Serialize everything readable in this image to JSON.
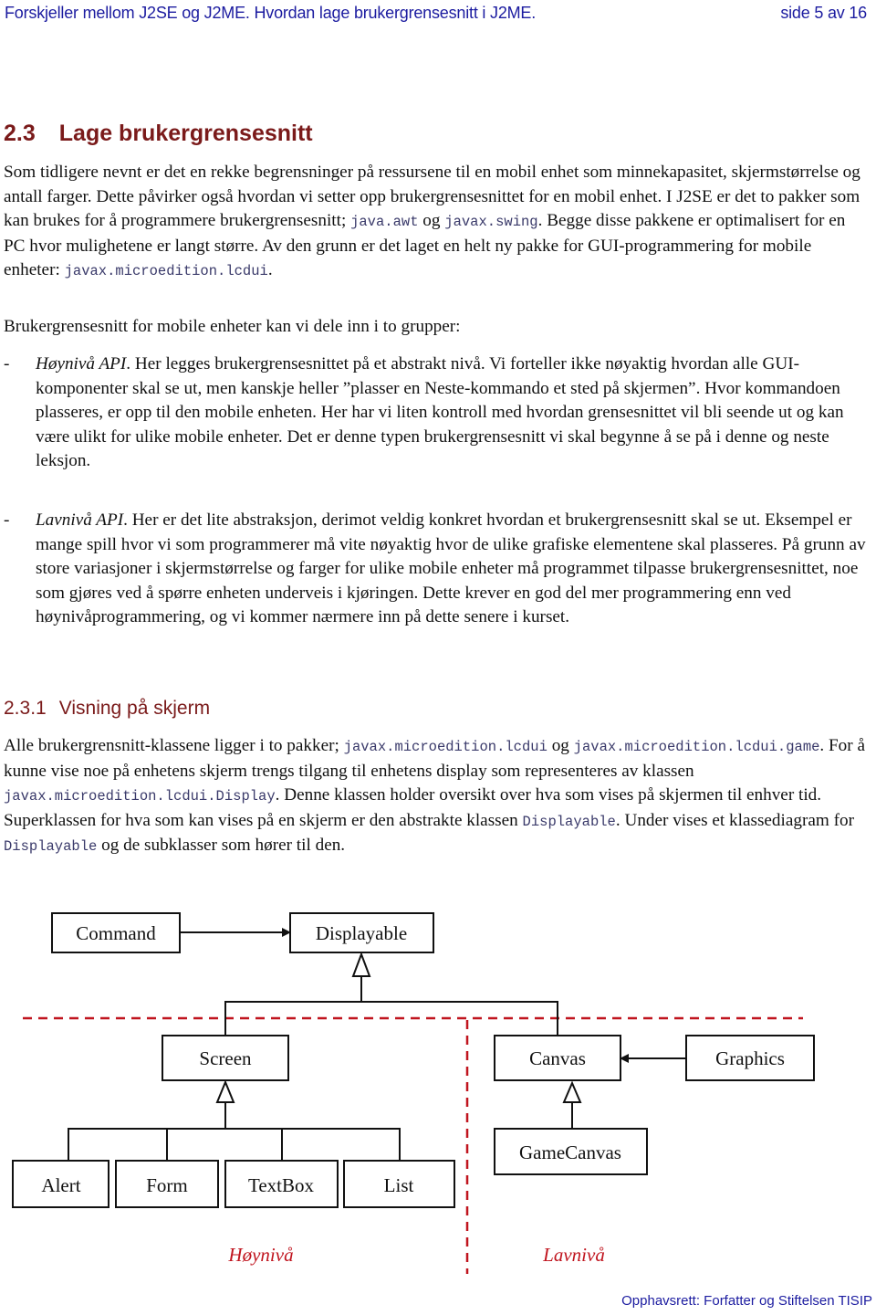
{
  "header": {
    "title": "Forskjeller mellom J2SE og J2ME. Hvordan lage brukergrensesnitt i J2ME.",
    "page": "side 5 av 16"
  },
  "section": {
    "number": "2.3",
    "title": "Lage brukergrensesnitt"
  },
  "intro": {
    "t1": "Som tidligere nevnt er det en rekke begrensninger på ressursene til en mobil enhet som minnekapasitet, skjermstørrelse og antall farger. Dette påvirker også hvordan vi setter opp brukergrensesnittet for en mobil enhet. I J2SE er det to pakker som kan brukes for å programmere brukergrensesnitt; ",
    "code1": "java.awt",
    "t2": " og ",
    "code2": "javax.swing",
    "t3": ". Begge disse pakkene er optimalisert for en PC hvor mulighetene er langt større. Av den grunn er det laget en helt ny pakke for GUI-programmering for mobile enheter: ",
    "code3": "javax.microedition.lcdui",
    "t4": "."
  },
  "groups_intro": "Brukergrensesnitt for mobile enheter kan vi dele inn i to grupper:",
  "groups": [
    {
      "dash": "-",
      "term": "Høynivå API",
      "text": ". Her legges brukergrensesnittet på et abstrakt nivå. Vi forteller ikke nøyaktig hvordan alle GUI-komponenter skal se ut, men kanskje heller ”plasser en Neste-kommando et sted på skjermen”. Hvor kommandoen plasseres, er opp til den mobile enheten. Her har vi liten kontroll med hvordan grensesnittet vil bli seende ut og kan være ulikt for ulike mobile enheter. Det er denne typen brukergrensesnitt vi skal begynne å se på i denne og neste leksjon."
    },
    {
      "dash": "-",
      "term": "Lavnivå API",
      "text": ". Her er det lite abstraksjon, derimot veldig konkret hvordan et brukergrensesnitt skal se ut. Eksempel er mange spill hvor vi som programmerer må vite nøyaktig hvor de ulike grafiske elementene skal plasseres. På grunn av store variasjoner i skjermstørrelse og farger for ulike mobile enheter må programmet tilpasse brukergrensesnittet, noe som gjøres ved å spørre enheten underveis i kjøringen. Dette krever en god del mer programmering enn ved høynivåprogrammering, og vi kommer nærmere inn på dette senere i kurset."
    }
  ],
  "subsection": {
    "number": "2.3.1",
    "title": "Visning på skjerm"
  },
  "display_para": {
    "t1": "Alle brukergrensnitt-klassene ligger i to pakker; ",
    "code1": "javax.microedition.lcdui",
    "t2": " og ",
    "code2": "javax.microedition.lcdui.game",
    "t3": ". For å kunne vise noe på enhetens skjerm trengs tilgang til enhetens display som representeres av klassen ",
    "code3": "javax.microedition.lcdui.Display",
    "t4": ". Denne klassen holder oversikt over hva som vises på skjermen til enhver tid. Superklassen for hva som kan vises på en skjerm er den abstrakte klassen ",
    "code4": "Displayable",
    "t5": ". Under vises et klassediagram for ",
    "code5": "Displayable",
    "t6": " og de subklasser som hører til den."
  },
  "diagram": {
    "classes": {
      "command": "Command",
      "displayable": "Displayable",
      "screen": "Screen",
      "canvas": "Canvas",
      "graphics": "Graphics",
      "gamecanvas": "GameCanvas",
      "alert": "Alert",
      "form": "Form",
      "textbox": "TextBox",
      "list": "List"
    },
    "relations": [
      {
        "from": "Command",
        "to": "Displayable",
        "type": "association"
      },
      {
        "from": "Graphics",
        "to": "Canvas",
        "type": "association"
      },
      {
        "from": "Screen",
        "to": "Displayable",
        "type": "inheritance"
      },
      {
        "from": "Canvas",
        "to": "Displayable",
        "type": "inheritance"
      },
      {
        "from": "Alert",
        "to": "Screen",
        "type": "inheritance"
      },
      {
        "from": "Form",
        "to": "Screen",
        "type": "inheritance"
      },
      {
        "from": "TextBox",
        "to": "Screen",
        "type": "inheritance"
      },
      {
        "from": "List",
        "to": "Screen",
        "type": "inheritance"
      },
      {
        "from": "GameCanvas",
        "to": "Canvas",
        "type": "inheritance"
      }
    ],
    "level_high": "Høynivå",
    "level_low": "Lavnivå",
    "divider_color": "#c0141e"
  },
  "footer": "Opphavsrett:  Forfatter og Stiftelsen TISIP"
}
